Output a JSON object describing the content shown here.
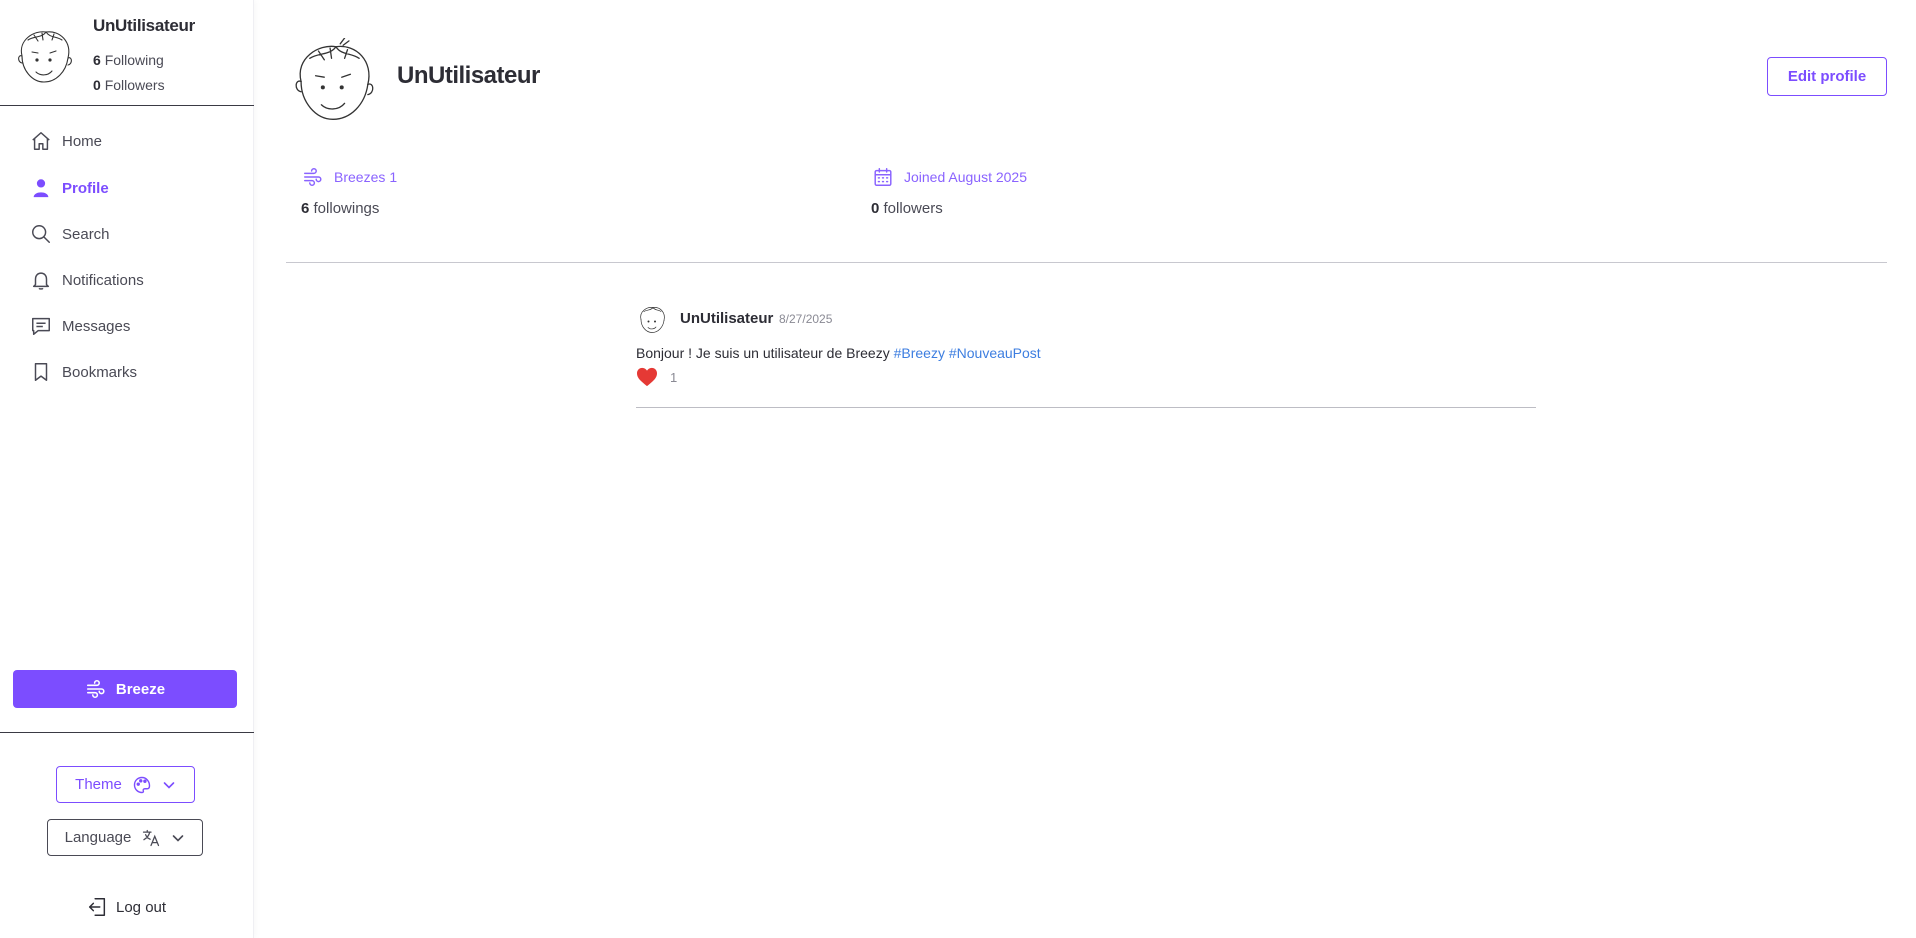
{
  "sidebar": {
    "user": {
      "name": "UnUtilisateur",
      "following_count": "6",
      "following_label": "Following",
      "followers_count": "0",
      "followers_label": "Followers"
    },
    "nav": [
      {
        "label": "Home",
        "icon": "home-icon",
        "active": false
      },
      {
        "label": "Profile",
        "icon": "user-icon",
        "active": true
      },
      {
        "label": "Search",
        "icon": "search-icon",
        "active": false
      },
      {
        "label": "Notifications",
        "icon": "bell-icon",
        "active": false
      },
      {
        "label": "Messages",
        "icon": "message-icon",
        "active": false
      },
      {
        "label": "Bookmarks",
        "icon": "bookmark-icon",
        "active": false
      }
    ],
    "breeze_label": "Breeze",
    "theme_label": "Theme",
    "language_label": "Language",
    "logout_label": "Log out"
  },
  "profile": {
    "name": "UnUtilisateur",
    "edit_label": "Edit profile",
    "breezes_label": "Breezes",
    "breezes_count": "1",
    "joined_label": "Joined August 2025",
    "followings_count": "6",
    "followings_label": "followings",
    "followers_count": "0",
    "followers_label": "followers"
  },
  "posts": [
    {
      "author": "UnUtilisateur",
      "date": "8/27/2025",
      "text": "Bonjour ! Je suis un utilisateur de Breezy",
      "tags": [
        "#Breezy",
        "#NouveauPost"
      ],
      "likes": "1"
    }
  ],
  "colors": {
    "accent": "#7c4dff",
    "link": "#3d7ee0",
    "heart": "#e53935",
    "text": "#2d2d35"
  }
}
